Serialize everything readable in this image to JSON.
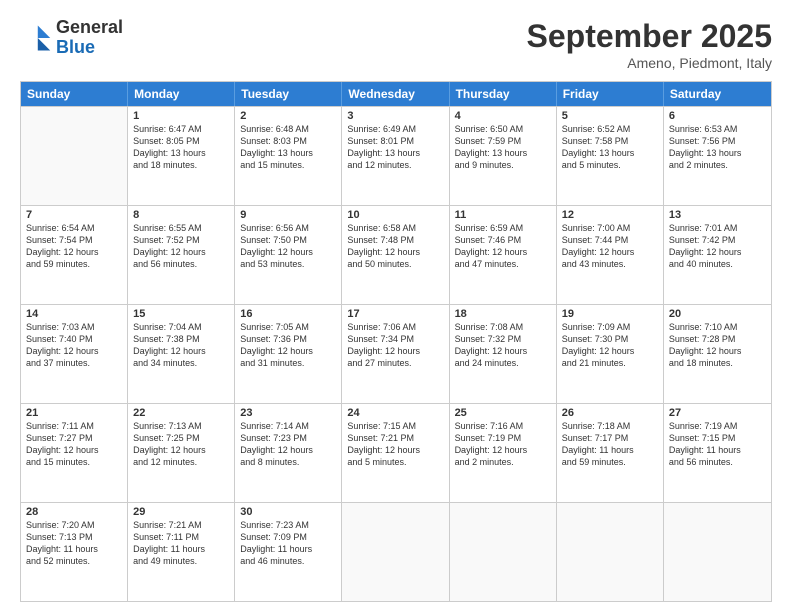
{
  "header": {
    "logo_general": "General",
    "logo_blue": "Blue",
    "month": "September 2025",
    "location": "Ameno, Piedmont, Italy"
  },
  "days_of_week": [
    "Sunday",
    "Monday",
    "Tuesday",
    "Wednesday",
    "Thursday",
    "Friday",
    "Saturday"
  ],
  "weeks": [
    [
      {
        "day": "",
        "info": ""
      },
      {
        "day": "1",
        "info": "Sunrise: 6:47 AM\nSunset: 8:05 PM\nDaylight: 13 hours\nand 18 minutes."
      },
      {
        "day": "2",
        "info": "Sunrise: 6:48 AM\nSunset: 8:03 PM\nDaylight: 13 hours\nand 15 minutes."
      },
      {
        "day": "3",
        "info": "Sunrise: 6:49 AM\nSunset: 8:01 PM\nDaylight: 13 hours\nand 12 minutes."
      },
      {
        "day": "4",
        "info": "Sunrise: 6:50 AM\nSunset: 7:59 PM\nDaylight: 13 hours\nand 9 minutes."
      },
      {
        "day": "5",
        "info": "Sunrise: 6:52 AM\nSunset: 7:58 PM\nDaylight: 13 hours\nand 5 minutes."
      },
      {
        "day": "6",
        "info": "Sunrise: 6:53 AM\nSunset: 7:56 PM\nDaylight: 13 hours\nand 2 minutes."
      }
    ],
    [
      {
        "day": "7",
        "info": "Sunrise: 6:54 AM\nSunset: 7:54 PM\nDaylight: 12 hours\nand 59 minutes."
      },
      {
        "day": "8",
        "info": "Sunrise: 6:55 AM\nSunset: 7:52 PM\nDaylight: 12 hours\nand 56 minutes."
      },
      {
        "day": "9",
        "info": "Sunrise: 6:56 AM\nSunset: 7:50 PM\nDaylight: 12 hours\nand 53 minutes."
      },
      {
        "day": "10",
        "info": "Sunrise: 6:58 AM\nSunset: 7:48 PM\nDaylight: 12 hours\nand 50 minutes."
      },
      {
        "day": "11",
        "info": "Sunrise: 6:59 AM\nSunset: 7:46 PM\nDaylight: 12 hours\nand 47 minutes."
      },
      {
        "day": "12",
        "info": "Sunrise: 7:00 AM\nSunset: 7:44 PM\nDaylight: 12 hours\nand 43 minutes."
      },
      {
        "day": "13",
        "info": "Sunrise: 7:01 AM\nSunset: 7:42 PM\nDaylight: 12 hours\nand 40 minutes."
      }
    ],
    [
      {
        "day": "14",
        "info": "Sunrise: 7:03 AM\nSunset: 7:40 PM\nDaylight: 12 hours\nand 37 minutes."
      },
      {
        "day": "15",
        "info": "Sunrise: 7:04 AM\nSunset: 7:38 PM\nDaylight: 12 hours\nand 34 minutes."
      },
      {
        "day": "16",
        "info": "Sunrise: 7:05 AM\nSunset: 7:36 PM\nDaylight: 12 hours\nand 31 minutes."
      },
      {
        "day": "17",
        "info": "Sunrise: 7:06 AM\nSunset: 7:34 PM\nDaylight: 12 hours\nand 27 minutes."
      },
      {
        "day": "18",
        "info": "Sunrise: 7:08 AM\nSunset: 7:32 PM\nDaylight: 12 hours\nand 24 minutes."
      },
      {
        "day": "19",
        "info": "Sunrise: 7:09 AM\nSunset: 7:30 PM\nDaylight: 12 hours\nand 21 minutes."
      },
      {
        "day": "20",
        "info": "Sunrise: 7:10 AM\nSunset: 7:28 PM\nDaylight: 12 hours\nand 18 minutes."
      }
    ],
    [
      {
        "day": "21",
        "info": "Sunrise: 7:11 AM\nSunset: 7:27 PM\nDaylight: 12 hours\nand 15 minutes."
      },
      {
        "day": "22",
        "info": "Sunrise: 7:13 AM\nSunset: 7:25 PM\nDaylight: 12 hours\nand 12 minutes."
      },
      {
        "day": "23",
        "info": "Sunrise: 7:14 AM\nSunset: 7:23 PM\nDaylight: 12 hours\nand 8 minutes."
      },
      {
        "day": "24",
        "info": "Sunrise: 7:15 AM\nSunset: 7:21 PM\nDaylight: 12 hours\nand 5 minutes."
      },
      {
        "day": "25",
        "info": "Sunrise: 7:16 AM\nSunset: 7:19 PM\nDaylight: 12 hours\nand 2 minutes."
      },
      {
        "day": "26",
        "info": "Sunrise: 7:18 AM\nSunset: 7:17 PM\nDaylight: 11 hours\nand 59 minutes."
      },
      {
        "day": "27",
        "info": "Sunrise: 7:19 AM\nSunset: 7:15 PM\nDaylight: 11 hours\nand 56 minutes."
      }
    ],
    [
      {
        "day": "28",
        "info": "Sunrise: 7:20 AM\nSunset: 7:13 PM\nDaylight: 11 hours\nand 52 minutes."
      },
      {
        "day": "29",
        "info": "Sunrise: 7:21 AM\nSunset: 7:11 PM\nDaylight: 11 hours\nand 49 minutes."
      },
      {
        "day": "30",
        "info": "Sunrise: 7:23 AM\nSunset: 7:09 PM\nDaylight: 11 hours\nand 46 minutes."
      },
      {
        "day": "",
        "info": ""
      },
      {
        "day": "",
        "info": ""
      },
      {
        "day": "",
        "info": ""
      },
      {
        "day": "",
        "info": ""
      }
    ]
  ]
}
